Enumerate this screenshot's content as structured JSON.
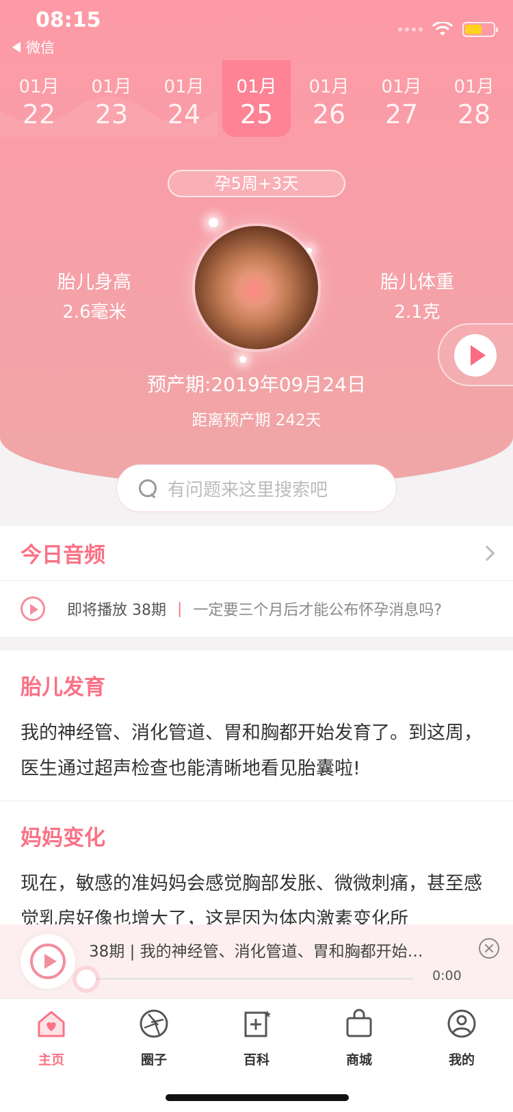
{
  "status_bar": {
    "time": "08:15",
    "back_label": "微信"
  },
  "dates": [
    {
      "month": "01月",
      "day": "22"
    },
    {
      "month": "01月",
      "day": "23"
    },
    {
      "month": "01月",
      "day": "24"
    },
    {
      "month": "01月",
      "day": "25",
      "active": true
    },
    {
      "month": "01月",
      "day": "26"
    },
    {
      "month": "01月",
      "day": "27"
    },
    {
      "month": "01月",
      "day": "28"
    }
  ],
  "pregnancy": {
    "week_label": "孕5周+3天",
    "height_label": "胎儿身高",
    "height_value": "2.6毫米",
    "weight_label": "胎儿体重",
    "weight_value": "2.1克",
    "due_date": "预产期:2019年09月24日",
    "countdown": "距离预产期 242天"
  },
  "search": {
    "placeholder": "有问题来这里搜索吧"
  },
  "audio": {
    "title": "今日音频",
    "upcoming": "即将播放 38期",
    "separator": "|",
    "topic": "一定要三个月后才能公布怀孕消息吗?"
  },
  "fetal_dev": {
    "title": "胎儿发育",
    "text": "我的神经管、消化管道、胃和胸都开始发育了。到这周，医生通过超声检查也能清晰地看见胎囊啦!"
  },
  "mom_change": {
    "title": "妈妈变化",
    "text": "现在，敏感的准妈妈会感觉胸部发胀、微微刺痛，甚至感觉乳房好像也增大了，这是因为体内激素变化所"
  },
  "player": {
    "title": "38期 | 我的神经管、消化管道、胃和胸都开始…",
    "time": "0:00",
    "progress": 0
  },
  "tabs": [
    {
      "label": "主页",
      "icon": "home-heart-icon",
      "active": true
    },
    {
      "label": "圈子",
      "icon": "aperture-icon"
    },
    {
      "label": "百科",
      "icon": "encyclopedia-icon"
    },
    {
      "label": "商城",
      "icon": "shopping-bag-icon"
    },
    {
      "label": "我的",
      "icon": "profile-icon"
    }
  ],
  "colors": {
    "accent": "#fb7185",
    "hero_top": "#fd9aa6",
    "hero_bottom": "#efa7a6",
    "active_date": "#fd8395"
  }
}
